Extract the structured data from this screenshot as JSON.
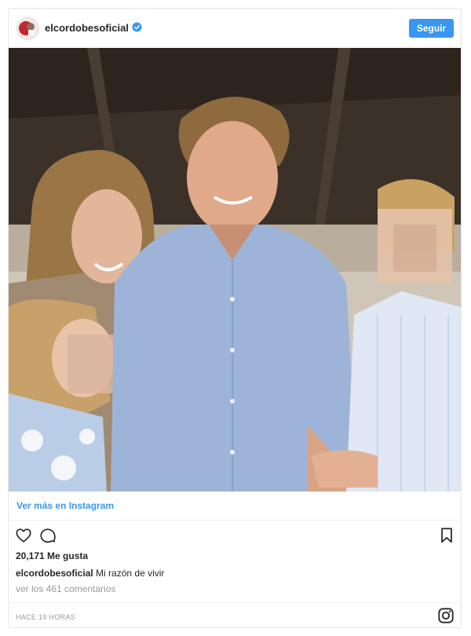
{
  "post": {
    "username": "elcordobesoficial",
    "follow_label": "Seguir",
    "view_more_label": "Ver más en Instagram",
    "likes": "20,171 Me gusta",
    "caption_user": "elcordobesoficial",
    "caption_text": "Mi razón de vivir",
    "comments_label": "ver los 461 comentarios",
    "timestamp": "HACE 19 HORAS"
  },
  "icons": {
    "verified": "verified-badge-icon",
    "like": "heart-icon",
    "comment": "comment-bubble-icon",
    "save": "bookmark-icon",
    "brand": "instagram-logo-icon"
  },
  "colors": {
    "accent": "#3897f0",
    "text": "#262626",
    "muted": "#999999",
    "border": "#e6e6e6"
  }
}
